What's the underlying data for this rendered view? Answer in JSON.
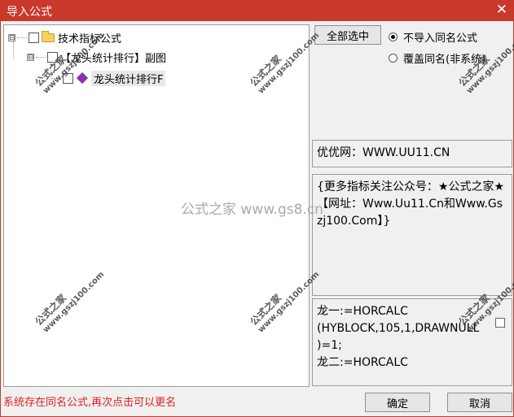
{
  "window": {
    "title": "导入公式",
    "close_glyph": "✕"
  },
  "tree": {
    "root": {
      "expander": "⊟",
      "label": "技术指标公式"
    },
    "group": {
      "expander": "⊟",
      "label": "【龙头统计排行】副图"
    },
    "formula": {
      "label": "龙头统计排行F"
    }
  },
  "right": {
    "select_all_label": "全部选中",
    "radio_options": [
      {
        "label": "不导入同名公式",
        "checked": true
      },
      {
        "label": "覆盖同名(非系统)",
        "checked": false
      }
    ]
  },
  "info_panel": {
    "text": "优优网：WWW.UU11.CN"
  },
  "desc_panel": {
    "text": "{更多指标关注公众号：★公式之家★【网址：Www.Uu11.Cn和Www.Gszj100.Com】}"
  },
  "code_panel": {
    "text": "龙一:=HORCALC\n(HYBLOCK,105,1,DRAWNULL\n)=1;\n龙二:=HORCALC"
  },
  "status_text": "系统存在同名公式,再次点击可以更名",
  "buttons": {
    "ok": "确定",
    "cancel": "取消"
  },
  "watermark": {
    "center": "公式之家 www.gs8.cn",
    "stamp_title": "公式之家",
    "stamp_url": "www.gszj100.com"
  },
  "colors": {
    "title_bar": "#c8392b",
    "status_text": "#e02020",
    "formula_icon": "#8d2fb5"
  }
}
